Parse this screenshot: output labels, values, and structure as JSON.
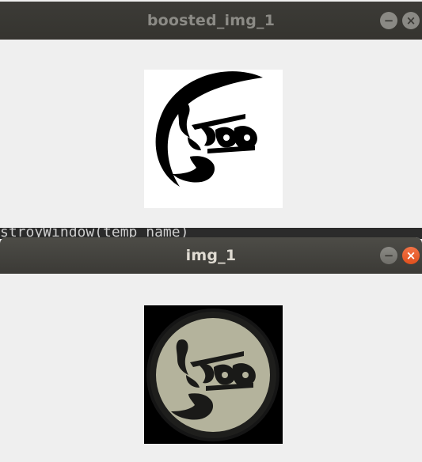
{
  "windows": {
    "boosted": {
      "title": "boosted_img_1",
      "minimize_icon": "minimize-icon",
      "close_icon": "close-icon",
      "minimize_glyph": "−",
      "close_glyph": "×"
    },
    "img": {
      "title": "img_1",
      "minimize_icon": "minimize-icon",
      "close_icon": "close-icon",
      "minimize_glyph": "−",
      "close_glyph": "×"
    }
  },
  "terminal": {
    "text": "stroyWindow(temp_name)"
  },
  "colors": {
    "titlebar_dark": "#3c3b37",
    "close_active": "#e95420",
    "window_bg": "#efefef",
    "coin_face": "#b4b39c"
  }
}
